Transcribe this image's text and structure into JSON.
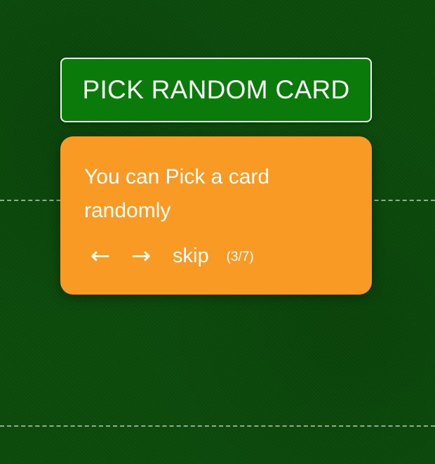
{
  "pick_button": {
    "label": "PICK RANDOM CARD"
  },
  "tooltip": {
    "text": "You can Pick a card randomly",
    "prev_glyph": "←",
    "next_glyph": "→",
    "skip_label": "skip",
    "progress": "(3/7)",
    "step_current": 3,
    "step_total": 7
  },
  "colors": {
    "background": "#0b4a0b",
    "button_bg": "#0a7a0a",
    "tooltip_bg": "#f89a23",
    "text": "#ffffff"
  },
  "icons": [
    "arrow-left-icon",
    "arrow-right-icon"
  ]
}
